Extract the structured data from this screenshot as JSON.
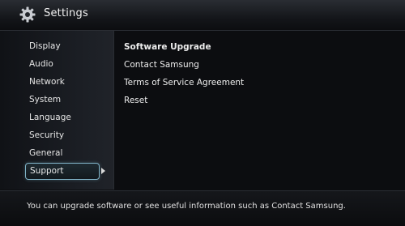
{
  "header": {
    "title": "Settings",
    "icon": "gear-icon"
  },
  "sidebar": {
    "items": [
      {
        "label": "Display"
      },
      {
        "label": "Audio"
      },
      {
        "label": "Network"
      },
      {
        "label": "System"
      },
      {
        "label": "Language"
      },
      {
        "label": "Security"
      },
      {
        "label": "General"
      },
      {
        "label": "Support",
        "selected": true
      }
    ]
  },
  "panel": {
    "options": [
      {
        "label": "Software Upgrade"
      },
      {
        "label": "Contact Samsung"
      },
      {
        "label": "Terms of Service Agreement"
      },
      {
        "label": "Reset"
      }
    ]
  },
  "footer": {
    "info": "You can upgrade software or see useful information such as Contact Samsung."
  },
  "colors": {
    "selection_border": "#7fb2c6",
    "background": "#0c0d10"
  }
}
